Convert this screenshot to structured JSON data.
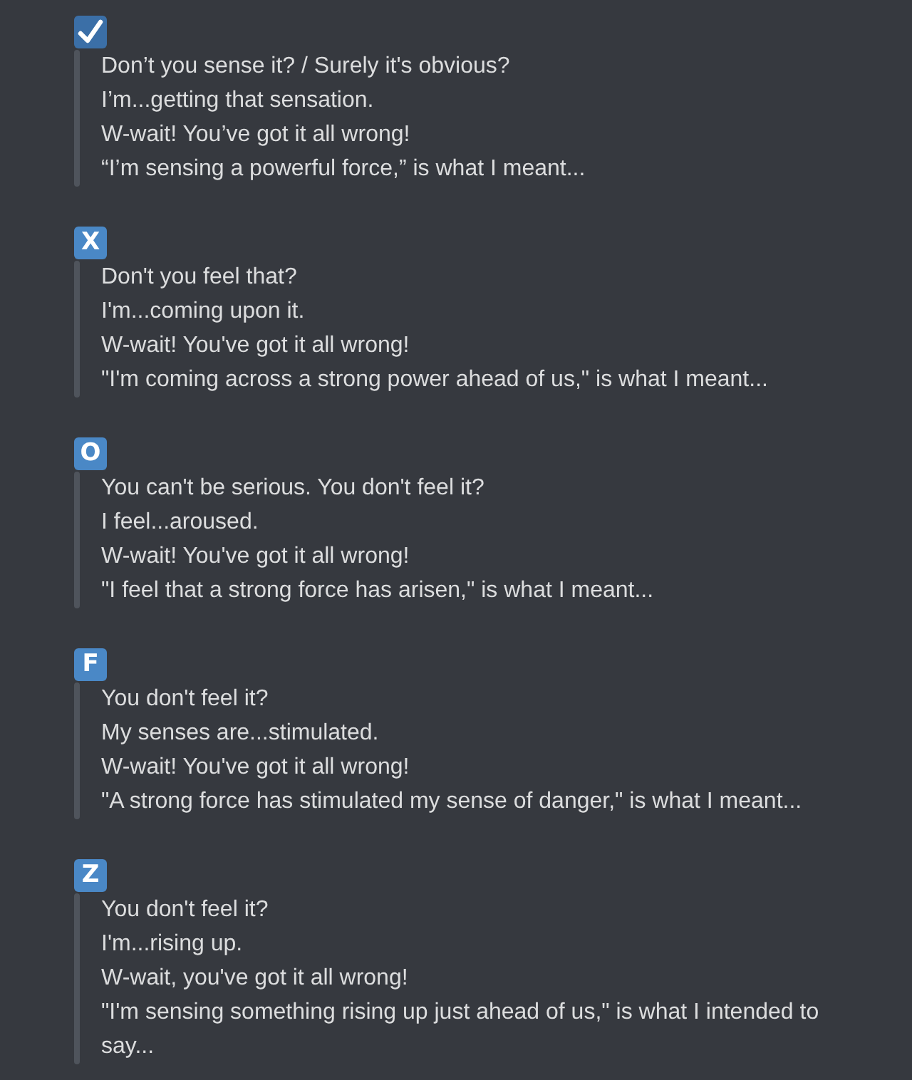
{
  "entries": [
    {
      "badge": {
        "kind": "check"
      },
      "lines": [
        "Don’t you sense it? / Surely it's obvious?",
        "I’m...getting that sensation.",
        "W-wait! You’ve got it all wrong!",
        "“I’m sensing a powerful force,” is what I meant..."
      ]
    },
    {
      "badge": {
        "kind": "letter",
        "letter": "X"
      },
      "lines": [
        "Don't you feel that?",
        "I'm...coming upon it.",
        "W-wait! You've got it all wrong!",
        "\"I'm coming across a strong power ahead of us,\" is what I meant..."
      ]
    },
    {
      "badge": {
        "kind": "letter",
        "letter": "O"
      },
      "lines": [
        "You can't be serious. You don't feel it?",
        "I feel...aroused.",
        "W-wait! You've got it all wrong!",
        "\"I feel that a strong force has arisen,\" is what I meant..."
      ]
    },
    {
      "badge": {
        "kind": "letter",
        "letter": "F"
      },
      "lines": [
        "You don't feel it?",
        "My senses are...stimulated.",
        "W-wait! You've got it all wrong!",
        "\"A strong force has stimulated my sense of danger,\" is what I meant..."
      ]
    },
    {
      "badge": {
        "kind": "letter",
        "letter": "Z"
      },
      "lines": [
        "You don't feel it?",
        "I'm...rising up.",
        "W-wait, you've got it all wrong!",
        "\"I'm sensing something rising up just ahead of us,\" is what I intended to say..."
      ]
    }
  ]
}
